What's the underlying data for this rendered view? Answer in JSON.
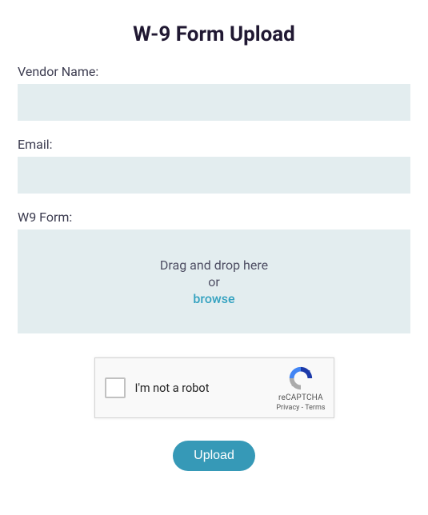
{
  "title": "W-9 Form Upload",
  "fields": {
    "vendor_name": {
      "label": "Vendor Name:",
      "value": ""
    },
    "email": {
      "label": "Email:",
      "value": ""
    },
    "w9": {
      "label": "W9 Form:",
      "drop_text": "Drag and drop here",
      "or_text": "or",
      "browse_text": "browse"
    }
  },
  "recaptcha": {
    "label": "I'm not a robot",
    "brand": "reCAPTCHA",
    "privacy_label": "Privacy",
    "terms_label": "Terms",
    "separator": " - "
  },
  "submit_label": "Upload",
  "colors": {
    "input_bg": "#e3edef",
    "accent_link": "#34a2c0",
    "button_bg": "#3699b7"
  }
}
